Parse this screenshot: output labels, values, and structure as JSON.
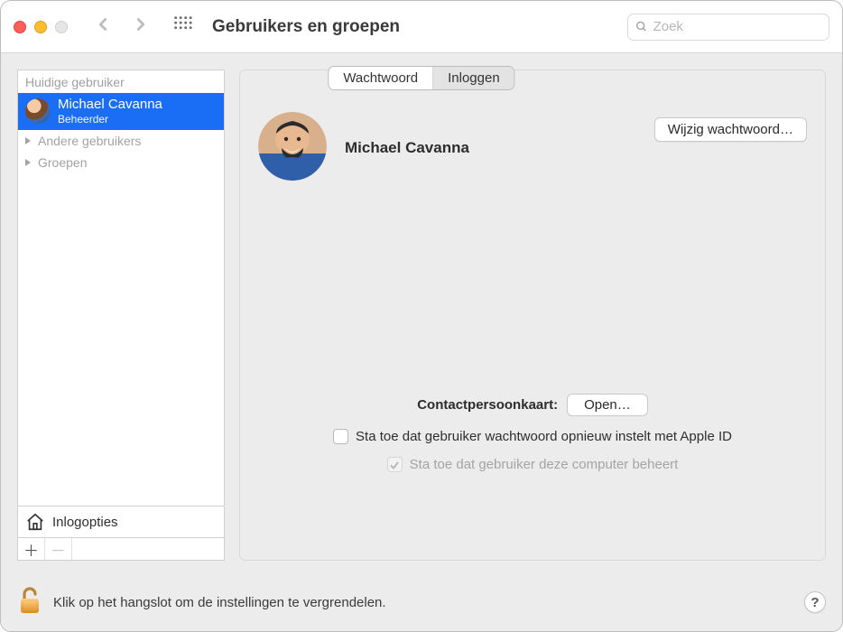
{
  "window": {
    "title": "Gebruikers en groepen",
    "search_placeholder": "Zoek"
  },
  "tabs": {
    "password": "Wachtwoord",
    "login": "Inloggen",
    "active": "password"
  },
  "sidebar": {
    "current_user_header": "Huidige gebruiker",
    "current_user": {
      "name": "Michael Cavanna",
      "role": "Beheerder"
    },
    "rows": [
      {
        "label": "Andere gebruikers"
      },
      {
        "label": "Groepen"
      }
    ],
    "login_options": "Inlogopties"
  },
  "main": {
    "user_name": "Michael Cavanna",
    "change_password_button": "Wijzig wachtwoord…",
    "contact_label": "Contactpersoonkaart:",
    "open_button": "Open…",
    "allow_reset_apple_id": "Sta toe dat gebruiker wachtwoord opnieuw instelt met Apple ID",
    "allow_admin": "Sta toe dat gebruiker deze computer beheert"
  },
  "lockbar": {
    "text": "Klik op het hangslot om de instellingen te vergrendelen.",
    "help": "?"
  }
}
